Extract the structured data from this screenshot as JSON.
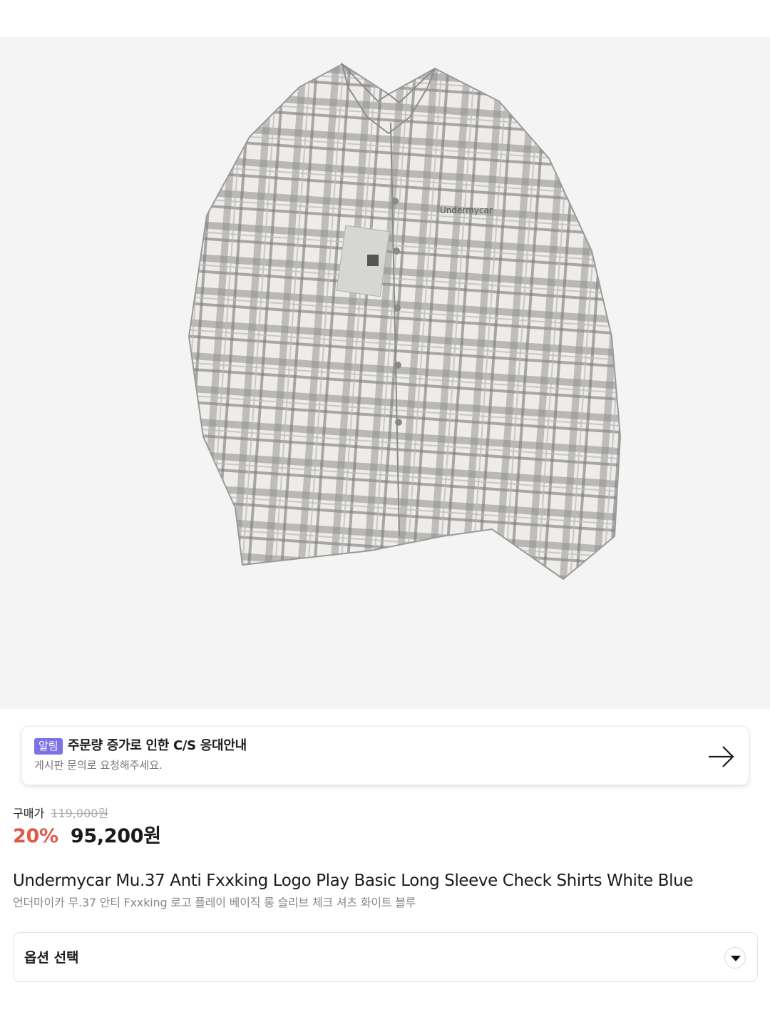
{
  "product_image": {
    "alt": "Undermycar check shirt",
    "tag_logo_text": "Undermycar"
  },
  "notice": {
    "badge": "알림",
    "title": "주문량 증가로 인한 C/S 응대안내",
    "subtitle": "게시판 문의로 요청해주세요."
  },
  "price": {
    "label": "구매가",
    "original": "119,000원",
    "discount": "20%",
    "sale": "95,200원"
  },
  "product": {
    "name": "Undermycar Mu.37 Anti Fxxking Logo Play Basic Long Sleeve Check Shirts White Blue",
    "name_ko": "언더마이카 무.37 안티 Fxxking 로고 플레이 베이직 롱 슬리브 체크 셔츠 화이트 블루"
  },
  "option": {
    "label": "옵션 선택"
  },
  "colors": {
    "badge": "#7b72e6",
    "discount": "#e05a4a",
    "image_bg": "#f4f4f4"
  },
  "icons": {
    "notice_arrow": "arrow-right-icon",
    "option_toggle": "chevron-down-icon"
  }
}
